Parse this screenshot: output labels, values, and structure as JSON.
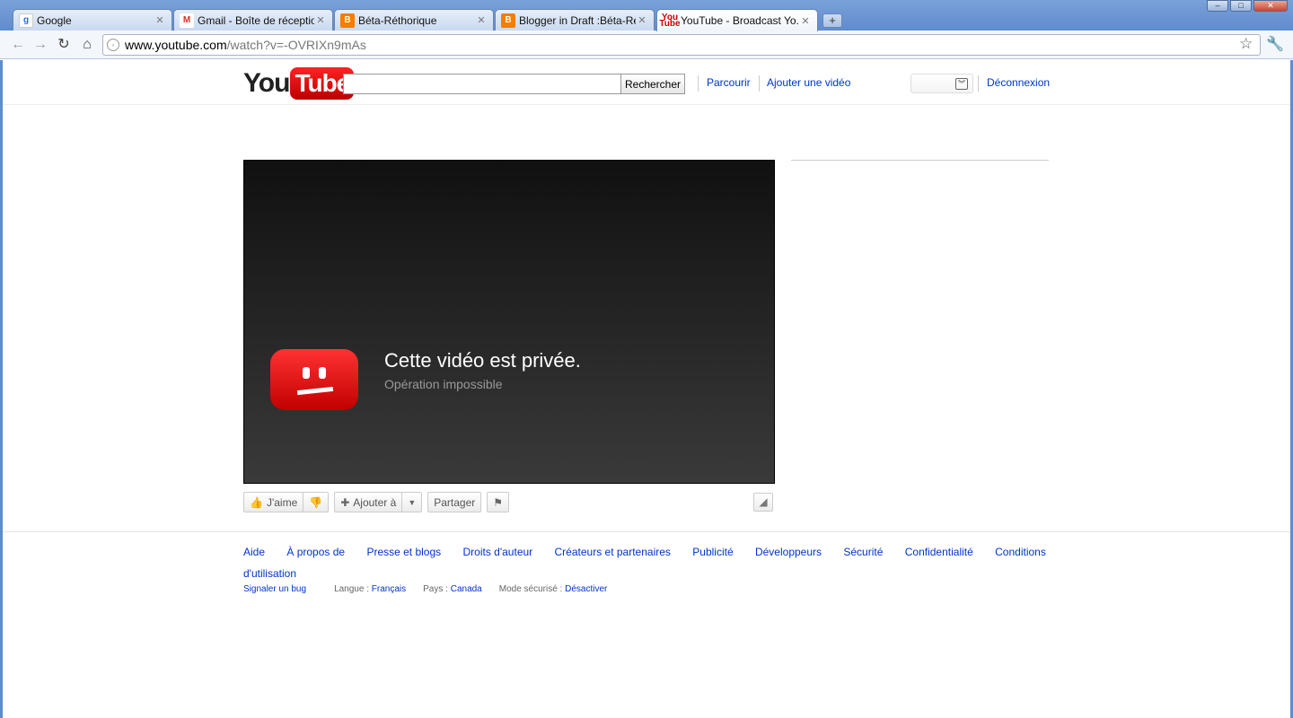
{
  "browser": {
    "tabs": [
      {
        "title": "Google",
        "favicon": "google-icon",
        "active": false
      },
      {
        "title": "Gmail - Boîte de réceptio...",
        "favicon": "gmail-icon",
        "active": false
      },
      {
        "title": "Béta-Réthorique",
        "favicon": "blogger-icon",
        "active": false
      },
      {
        "title": "Blogger in Draft :Béta-Rét...",
        "favicon": "blogger-icon",
        "active": false
      },
      {
        "title": "YouTube - Broadcast Yo...",
        "favicon": "youtube-icon",
        "active": true
      }
    ],
    "url_host": "www.youtube.com",
    "url_path": "/watch?v=-OVRIXn9mAs"
  },
  "header": {
    "logo_you": "You",
    "logo_tube": "Tube",
    "search_button": "Rechercher",
    "search_value": "",
    "browse_link": "Parcourir",
    "upload_link": "Ajouter une vidéo",
    "logout_link": "Déconnexion"
  },
  "player": {
    "error_title": "Cette vidéo est privée.",
    "error_subtitle": "Opération impossible"
  },
  "actions": {
    "like": "J'aime",
    "add_to": "Ajouter à",
    "share": "Partager"
  },
  "footer": {
    "links": [
      "Aide",
      "À propos de",
      "Presse et blogs",
      "Droits d'auteur",
      "Créateurs et partenaires",
      "Publicité",
      "Développeurs",
      "Sécurité",
      "Confidentialité",
      "Conditions d'utilisation"
    ],
    "report_bug": "Signaler un bug",
    "language_label": "Langue :",
    "language_value": "Français",
    "country_label": "Pays :",
    "country_value": "Canada",
    "safety_label": "Mode sécurisé :",
    "safety_value": "Désactiver"
  },
  "colors": {
    "link": "#0033cc",
    "brand_red": "#cc0000",
    "chrome_blue": "#5f8ccd"
  }
}
